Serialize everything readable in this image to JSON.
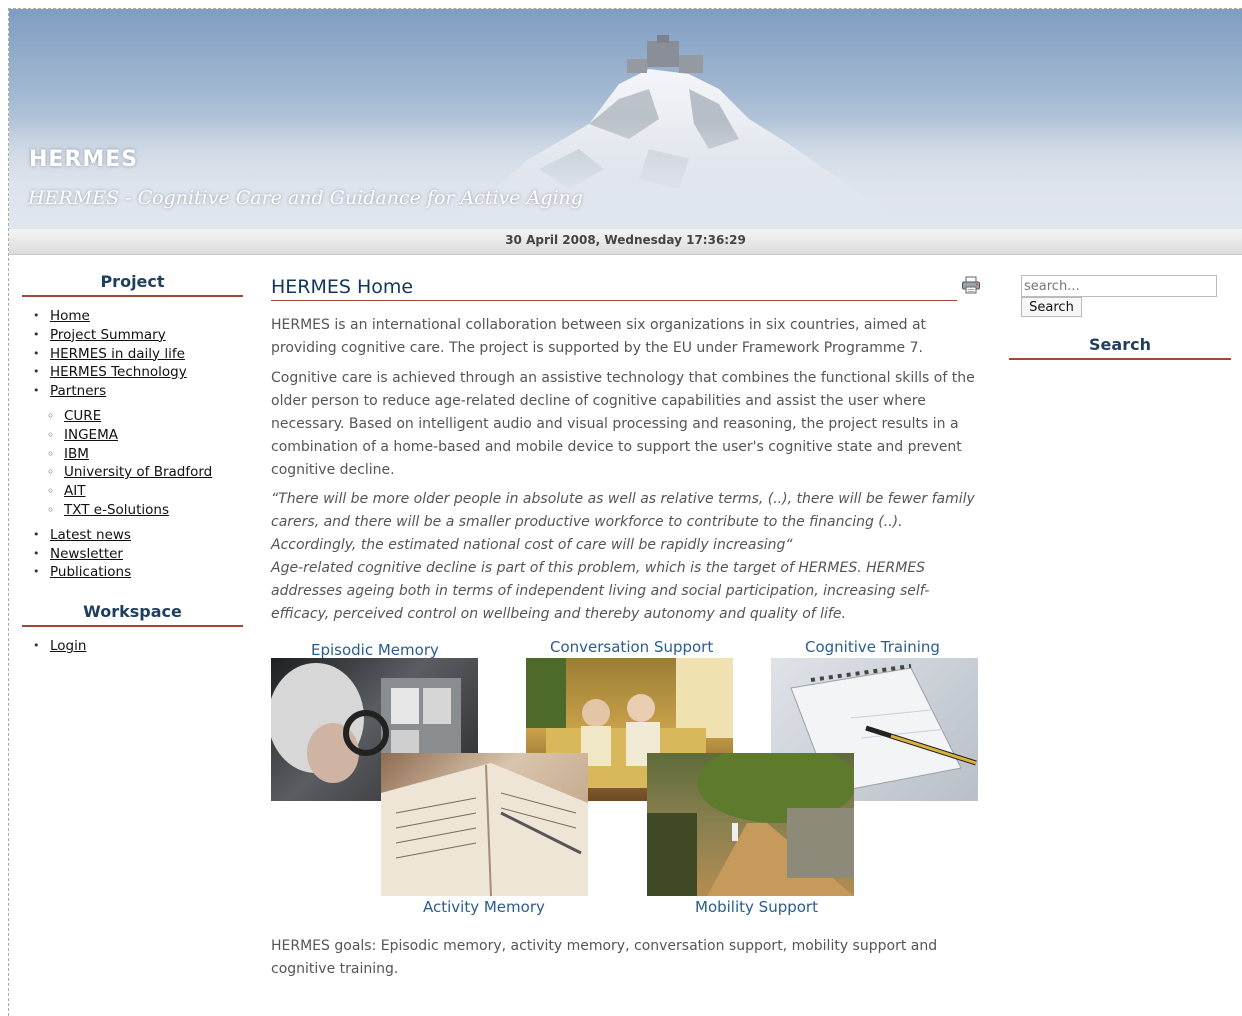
{
  "header": {
    "site_title": "HERMES",
    "slogan": "HERMES - Cognitive Care and Guidance for Active Aging",
    "datetime": "30 April 2008, Wednesday 17:36:29"
  },
  "left_sidebar": {
    "project_title": "Project",
    "menu": [
      {
        "label": "Home"
      },
      {
        "label": "Project Summary"
      },
      {
        "label": "HERMES in daily life"
      },
      {
        "label": "HERMES Technology"
      },
      {
        "label": "Partners"
      }
    ],
    "partners": [
      {
        "label": "CURE"
      },
      {
        "label": "INGEMA"
      },
      {
        "label": "IBM"
      },
      {
        "label": "University of Bradford"
      },
      {
        "label": "AIT"
      },
      {
        "label": "TXT e-Solutions"
      }
    ],
    "menu_after": [
      {
        "label": "Latest news"
      },
      {
        "label": "Newsletter"
      },
      {
        "label": "Publications"
      }
    ],
    "workspace_title": "Workspace",
    "workspace_menu": [
      {
        "label": "Login"
      }
    ]
  },
  "main": {
    "title": "HERMES Home",
    "para1": "HERMES is an international collaboration between six organizations in six countries, aimed at providing cognitive care. The project is supported by the EU under Framework Programme 7.",
    "para2": "Cognitive care is achieved through an assistive technology that combines the functional skills of the older person to reduce age-related decline of cognitive capabilities and assist the user where necessary. Based on intelligent audio and visual processing and reasoning, the project results in a combination of a home-based and mobile device to support the user's cognitive state and prevent cognitive decline.",
    "quote1": "“There will be more older people in absolute as well as relative terms, (..), there will be fewer family carers, and there will be a smaller productive workforce to contribute to the financing (..). Accordingly, the estimated national cost of care will be rapidly increasing“",
    "quote2": "Age-related cognitive decline is part of this problem, which is the target of HERMES. HERMES addresses ageing both in terms of independent living and social participation, increasing self-efficacy, perceived control on wellbeing and thereby autonomy and quality of life.",
    "collage_labels": {
      "episodic": "Episodic Memory",
      "conversation": "Conversation Support",
      "cognitive": "Cognitive Training",
      "activity": "Activity Memory",
      "mobility": "Mobility Support"
    },
    "caption": "HERMES goals: Episodic memory, activity memory, conversation support, mobility support and cognitive training."
  },
  "right_sidebar": {
    "search_placeholder": "search...",
    "search_button": "Search",
    "search_title": "Search"
  },
  "colors": {
    "title_blue": "#1f3f5e",
    "rule_red": "#a04a35",
    "collage_label_blue": "#2b5c8f"
  }
}
